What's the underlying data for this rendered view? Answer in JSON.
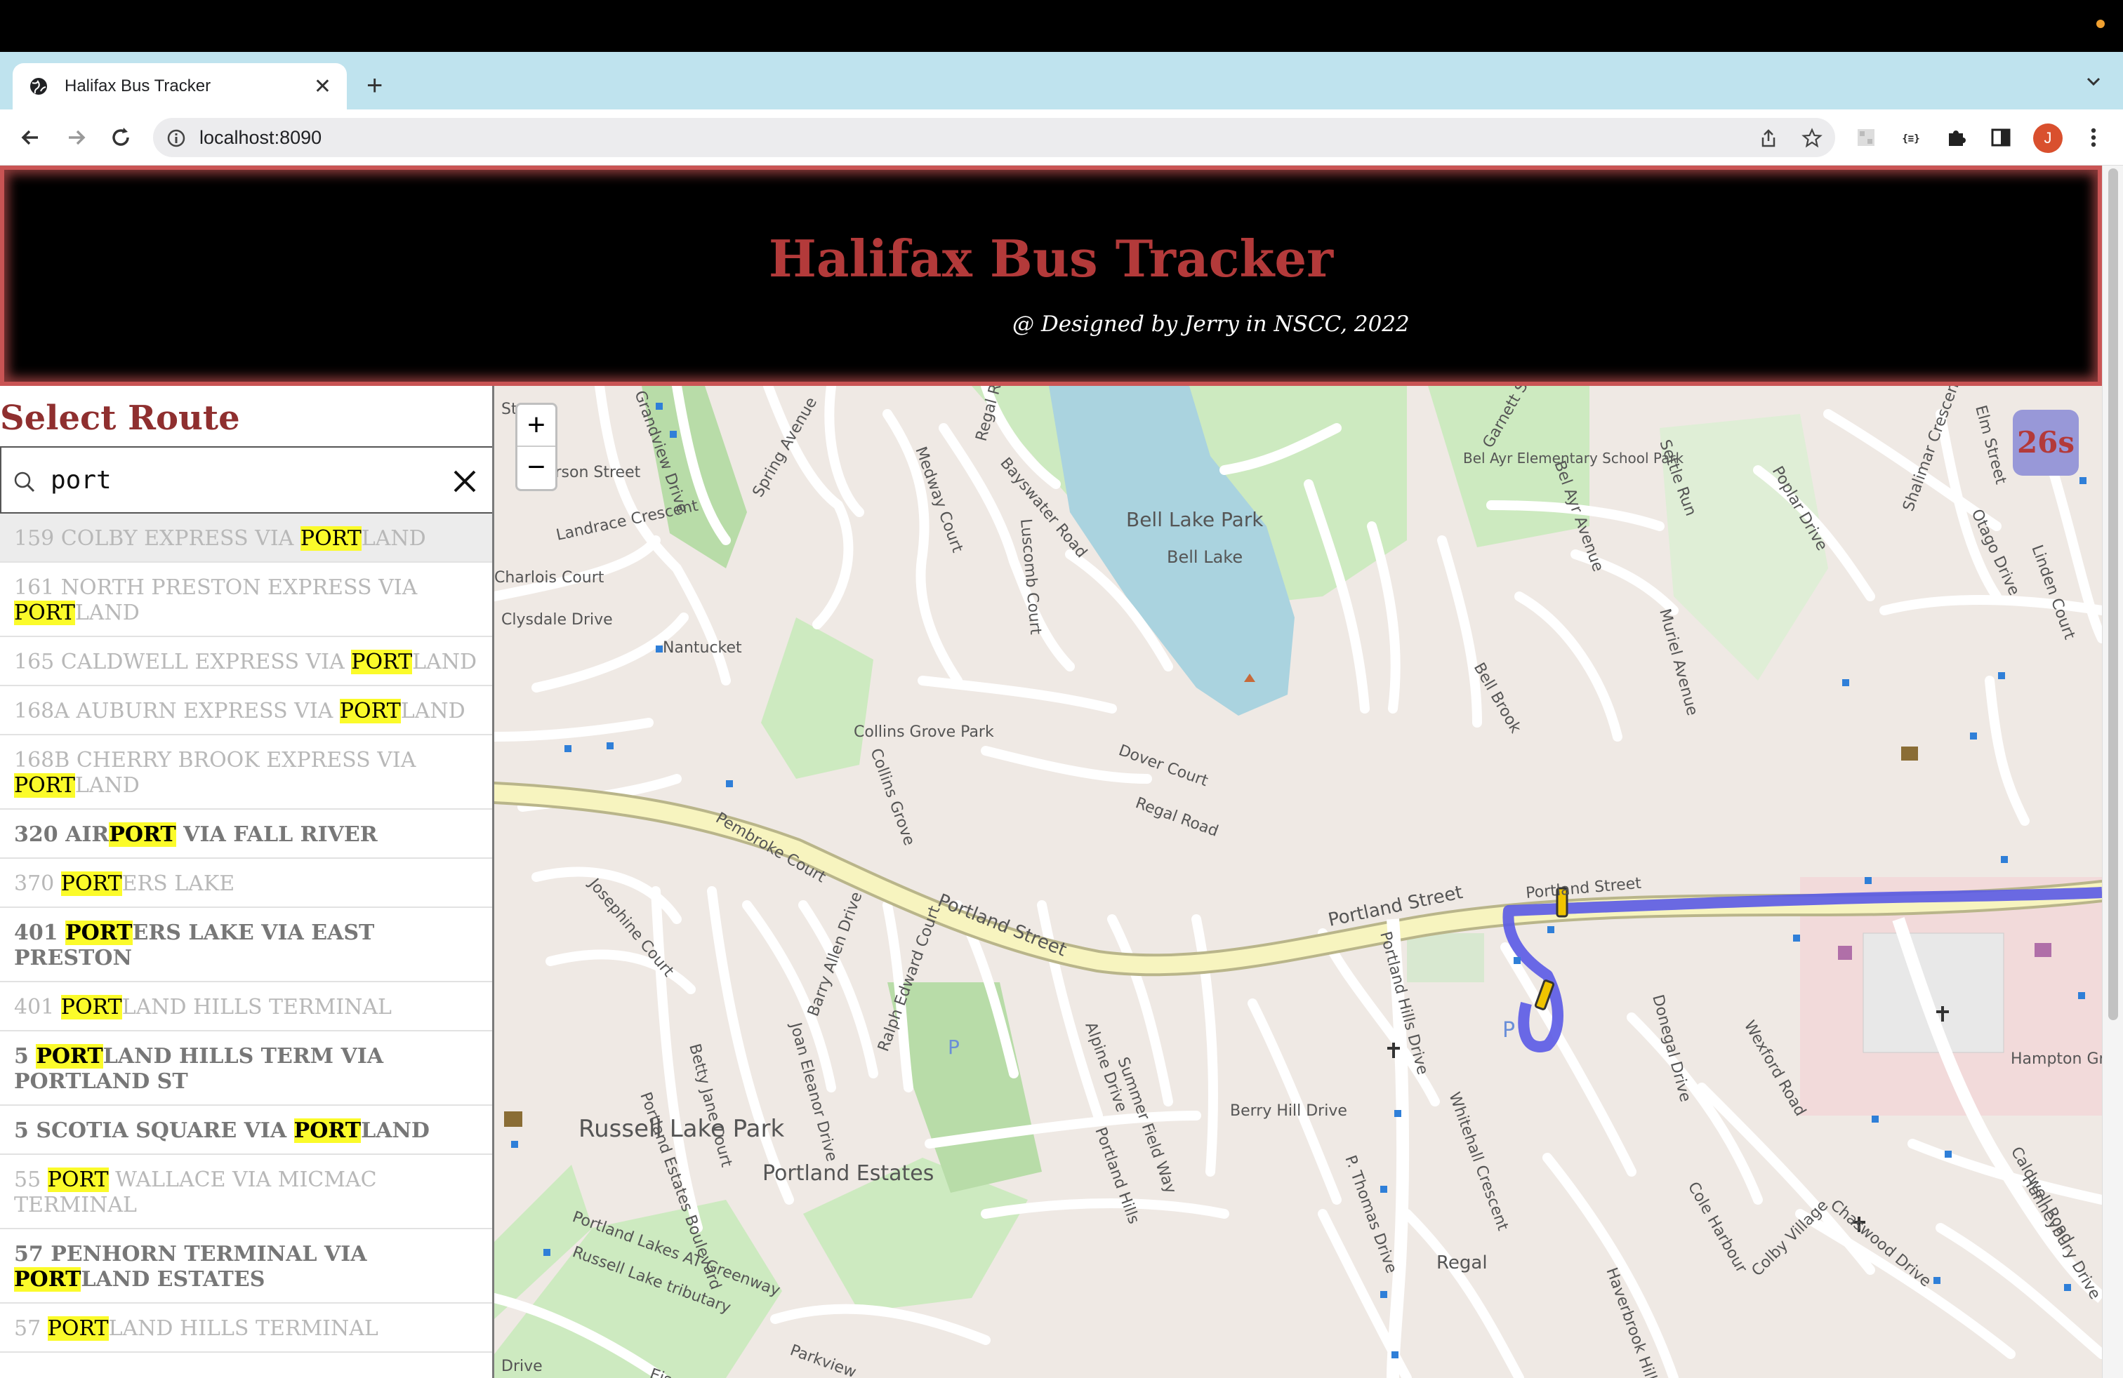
{
  "browser": {
    "tab_title": "Halifax Bus Tracker",
    "url": "localhost:8090",
    "avatar_letter": "J"
  },
  "header": {
    "title": "Halifax Bus Tracker",
    "subtitle": "@ Designed by Jerry in NSCC, 2022"
  },
  "sidebar": {
    "heading": "Select Route",
    "search_value": "port",
    "routes": [
      {
        "pre": "159 COLBY EXPRESS VIA ",
        "match": "PORT",
        "post": "LAND",
        "style": "dim"
      },
      {
        "pre": "161 NORTH PRESTON EXPRESS VIA ",
        "match": "PORT",
        "post": "LAND",
        "style": "dim"
      },
      {
        "pre": "165 CALDWELL EXPRESS VIA ",
        "match": "PORT",
        "post": "LAND",
        "style": "dim"
      },
      {
        "pre": "168A AUBURN EXPRESS VIA ",
        "match": "PORT",
        "post": "LAND",
        "style": "dim"
      },
      {
        "pre": "168B CHERRY BROOK EXPRESS VIA ",
        "match": "PORT",
        "post": "LAND",
        "style": "dim"
      },
      {
        "pre": "320 AIR",
        "match": "PORT",
        "post": " VIA FALL RIVER",
        "style": "bold"
      },
      {
        "pre": "370 ",
        "match": "PORT",
        "post": "ERS LAKE",
        "style": "dim"
      },
      {
        "pre": "401 ",
        "match": "PORT",
        "post": "ERS LAKE VIA EAST PRESTON",
        "style": "bold"
      },
      {
        "pre": "401 ",
        "match": "PORT",
        "post": "LAND HILLS TERMINAL",
        "style": "dim"
      },
      {
        "pre": "5 ",
        "match": "PORT",
        "post": "LAND HILLS TERM VIA PORTLAND ST",
        "style": "bold"
      },
      {
        "pre": "5 SCOTIA SQUARE VIA ",
        "match": "PORT",
        "post": "LAND",
        "style": "bold"
      },
      {
        "pre": "55 ",
        "match": "PORT",
        "post": " WALLACE VIA MICMAC TERMINAL",
        "style": "dim"
      },
      {
        "pre": "57 PENHORN TERMINAL VIA ",
        "match": "PORT",
        "post": "LAND ESTATES",
        "style": "bold"
      },
      {
        "pre": "57 ",
        "match": "PORT",
        "post": "LAND HILLS TERMINAL",
        "style": "dim"
      }
    ]
  },
  "map": {
    "zoom_in": "+",
    "zoom_out": "−",
    "refresh_countdown": "26s",
    "route_color": "#5a5ae6",
    "labels": [
      "Street",
      "Anderson Street",
      "Landrace Crescent",
      "Charlois Court",
      "Clysdale Drive",
      "Nantucket",
      "Grandview Drive",
      "Spring Avenue",
      "Medway Court",
      "Regal Road",
      "Luscomb Court",
      "Bayswater Road",
      "Bell Lake Park",
      "Bell Lake",
      "Bel Ayr Elementary School Park",
      "Garnett Street",
      "Bel Ayr Avenue",
      "Settle Run",
      "Poplar Drive",
      "Elm Street",
      "Shalimar Crescent",
      "Otago Drive",
      "Linden Court",
      "Collins Grove Park",
      "Pembroke Court",
      "Collins Grove",
      "Dover Court",
      "Regal Road",
      "Bell Brook",
      "Muriel Avenue",
      "Portland Street",
      "Portland Street",
      "Portland Street",
      "Josephine Court",
      "Portland Hills Drive",
      "Donegal Drive",
      "Wexford Road",
      "Hampton Green",
      "Russell Lake Park",
      "Betty Jane Court",
      "Joan Eleanor Drive",
      "Barry Allen Drive",
      "Ralph Edward Court",
      "Alpine Drive",
      "Summer Field Way",
      "Berry Hill Drive",
      "Portland Estates",
      "Portland Estates Boulevard",
      "Portland Lakes AT Greenway",
      "Russell Lake tributary",
      "Whitehall Crescent",
      "Regal",
      "Haverbrook Hill",
      "Colby Village",
      "Chaswood Drive",
      "Caldwell Road",
      "Hanneybury Drive",
      "Cole Harbour",
      "P. Thomas Drive",
      "Portland Hills",
      "Parkview",
      "Drive",
      "Eisener"
    ]
  }
}
